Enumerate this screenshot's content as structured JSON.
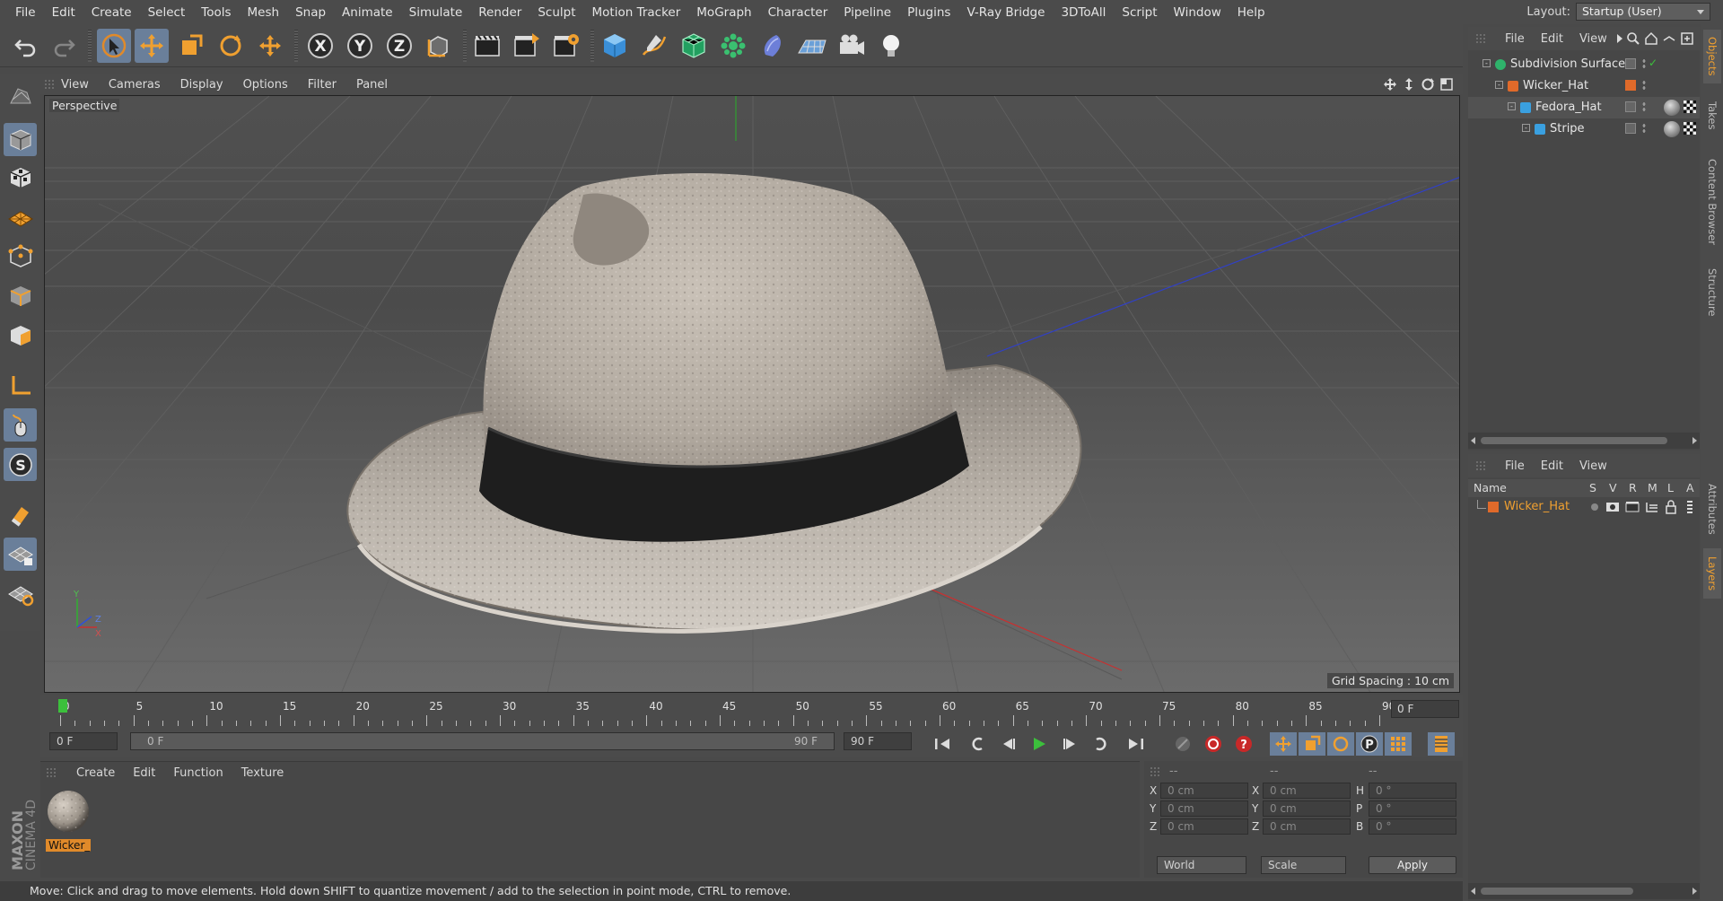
{
  "menu": [
    "File",
    "Edit",
    "Create",
    "Select",
    "Tools",
    "Mesh",
    "Snap",
    "Animate",
    "Simulate",
    "Render",
    "Sculpt",
    "Motion Tracker",
    "MoGraph",
    "Character",
    "Pipeline",
    "Plugins",
    "V-Ray Bridge",
    "3DToAll",
    "Script",
    "Window",
    "Help"
  ],
  "layout": {
    "label": "Layout:",
    "value": "Startup (User)"
  },
  "viewport": {
    "menu": [
      "View",
      "Cameras",
      "Display",
      "Options",
      "Filter",
      "Panel"
    ],
    "camera": "Perspective",
    "grid_spacing": "Grid Spacing : 10 cm"
  },
  "timeline": {
    "ticks": [
      "0",
      "5",
      "10",
      "15",
      "20",
      "25",
      "30",
      "35",
      "40",
      "45",
      "50",
      "55",
      "60",
      "65",
      "70",
      "75",
      "80",
      "85",
      "90"
    ],
    "current_frame": "0 F",
    "end_frame_field": "0 F",
    "start_field": "0 F",
    "range_start": "0 F",
    "range_end": "90 F",
    "max_field": "90 F"
  },
  "material": {
    "menu": [
      "Create",
      "Edit",
      "Function",
      "Texture"
    ],
    "items": [
      {
        "label": "Wicker_"
      }
    ]
  },
  "attributes": {
    "header": [
      "--",
      "--",
      "--"
    ],
    "rows": [
      {
        "a": "X",
        "av": "0 cm",
        "b": "X",
        "bv": "0 cm",
        "c": "H",
        "cv": "0 °"
      },
      {
        "a": "Y",
        "av": "0 cm",
        "b": "Y",
        "bv": "0 cm",
        "c": "P",
        "cv": "0 °"
      },
      {
        "a": "Z",
        "av": "0 cm",
        "b": "Z",
        "bv": "0 cm",
        "c": "B",
        "cv": "0 °"
      }
    ],
    "coord_mode": "World",
    "size_mode": "Scale",
    "apply": "Apply"
  },
  "status": "Move: Click and drag to move elements. Hold down SHIFT to quantize movement / add to the selection in point mode, CTRL to remove.",
  "objects": {
    "menu": [
      "File",
      "Edit",
      "View"
    ],
    "tree": [
      {
        "name": "Subdivision Surface",
        "color": "#2fb36b"
      },
      {
        "name": "Wicker_Hat",
        "color": "#e06a2a"
      },
      {
        "name": "Fedora_Hat",
        "color": "#3aa0e0"
      },
      {
        "name": "Stripe",
        "color": "#3aa0e0"
      }
    ]
  },
  "layers": {
    "menu": [
      "File",
      "Edit",
      "View"
    ],
    "columns": {
      "name": "Name",
      "flags": [
        "S",
        "V",
        "R",
        "M",
        "L",
        "A"
      ]
    },
    "rows": [
      {
        "name": "Wicker_Hat",
        "color": "#e06a2a"
      }
    ]
  },
  "side_tabs": [
    "Objects",
    "Takes",
    "Content Browser",
    "Structure",
    "Attributes",
    "Layers"
  ],
  "brand": {
    "maxon": "MAXON",
    "product": "CINEMA 4D"
  },
  "colors": {
    "accent": "#e08a2a",
    "select": "#6a7f9a",
    "x_axis": "#d23232",
    "y_axis": "#3cb43c",
    "z_axis": "#3050d8"
  }
}
